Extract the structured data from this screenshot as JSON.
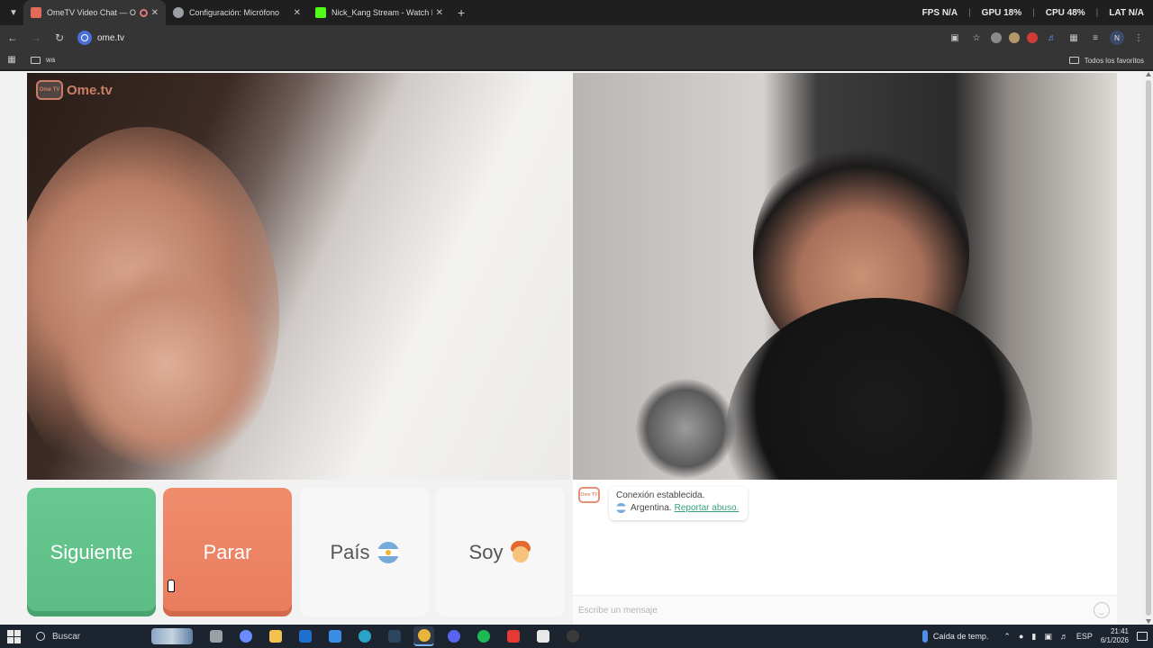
{
  "browser": {
    "tabs": [
      {
        "title": "OmeTV Video Chat — Ome",
        "favicon_color": "#e46a5a",
        "active": true,
        "recording": true
      },
      {
        "title": "Configuración: Micrófono",
        "favicon_color": "#9aa0a6",
        "active": false
      },
      {
        "title": "Nick_Kang Stream - Watch Liv",
        "favicon_color": "#53fc18",
        "active": false
      }
    ],
    "stats": [
      {
        "label": "FPS",
        "value": "N/A"
      },
      {
        "label": "GPU",
        "value": "18%"
      },
      {
        "label": "CPU",
        "value": "48%"
      },
      {
        "label": "LAT",
        "value": "N/A"
      }
    ],
    "url": "ome.tv",
    "profile_initial": "N",
    "bookmarks": [
      {
        "label": "wa"
      }
    ],
    "all_bookmarks": "Todos los favoritos"
  },
  "page": {
    "logo_text": "Ome.tv",
    "logo_small": "Ome TV",
    "buttons": {
      "next": "Siguiente",
      "stop": "Parar",
      "country": "País",
      "gender": "Soy"
    },
    "chat": {
      "status": "Conexión establecida.",
      "country": "Argentina.",
      "report_link": "Reportar abuso.",
      "input_placeholder": "Escribe un mensaje"
    },
    "colors": {
      "next": "#5dbf86",
      "stop": "#ec8365",
      "accent": "#e58f73",
      "link": "#37a37c"
    }
  },
  "taskbar": {
    "search_placeholder": "Buscar",
    "apps": [
      {
        "name": "task-view",
        "color": "#9aa0a6"
      },
      {
        "name": "copilot",
        "color": "#6a8cff"
      },
      {
        "name": "file-explorer",
        "color": "#f2c14e"
      },
      {
        "name": "outlook",
        "color": "#1f6fd1"
      },
      {
        "name": "store",
        "color": "#3a8ee6"
      },
      {
        "name": "edge",
        "color": "#2aa3c9"
      },
      {
        "name": "steam",
        "color": "#2a475e"
      },
      {
        "name": "chrome",
        "color": "#e9b43b",
        "active": true
      },
      {
        "name": "discord",
        "color": "#5865f2"
      },
      {
        "name": "spotify",
        "color": "#1db954"
      },
      {
        "name": "youtube",
        "color": "#e53935"
      },
      {
        "name": "capcut",
        "color": "#e8e8e8"
      },
      {
        "name": "obs",
        "color": "#3a3a3a"
      }
    ],
    "weather": "Caída de temp.",
    "language": "ESP",
    "time": "21:41",
    "date": "6/1/2026"
  }
}
